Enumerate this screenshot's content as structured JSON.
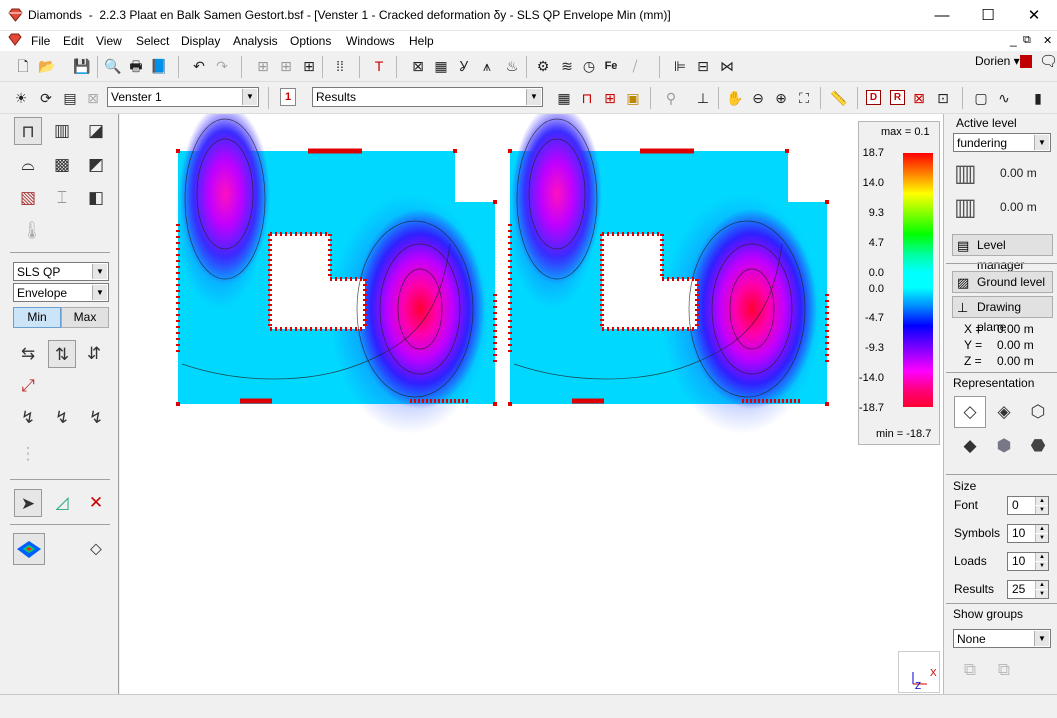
{
  "window": {
    "app_name": "Diamonds",
    "title_rest": "2.2.3 Plaat en Balk Samen Gestort.bsf - [Venster 1 - Cracked deformation δy - SLS QP Envelope Min  (mm)]",
    "minimize_glyph": "—",
    "maximize_glyph": "☐",
    "close_glyph": "✕"
  },
  "menu": {
    "items": [
      "File",
      "Edit",
      "View",
      "Select",
      "Display",
      "Analysis",
      "Options",
      "Windows",
      "Help"
    ],
    "user": "Dorien ▾",
    "mdi_min": "_",
    "mdi_restore": "⧉",
    "mdi_close": "✕"
  },
  "toolbar": {
    "window_combo": "Venster 1",
    "results_combo": "Results",
    "window_number": "1",
    "d_label": "D",
    "r_label": "R",
    "fe_label": "Fe"
  },
  "left_panel": {
    "combination_combo": "SLS QP",
    "envelope_combo": "Envelope",
    "min_tab": "Min",
    "max_tab": "Max"
  },
  "legend": {
    "max_label": "max = 0.1",
    "min_label": "min = -18.7",
    "ticks": [
      "18.7",
      "14.0",
      "9.3",
      "4.7",
      "0.0",
      "0.0",
      "-4.7",
      "-9.3",
      "-14.0",
      "-18.7"
    ]
  },
  "right_panel": {
    "active_level_title": "Active level",
    "level_combo": "fundering",
    "level_height_1": "0.00 m",
    "level_height_2": "0.00 m",
    "level_manager": "Level manager",
    "ground_level": "Ground level",
    "drawing_plane": "Drawing plane",
    "x_label": "X =",
    "x_value": "0.00 m",
    "y_label": "Y =",
    "y_value": "0.00 m",
    "z_label": "Z =",
    "z_value": "0.00 m",
    "representation_title": "Representation",
    "size_title": "Size",
    "font_label": "Font",
    "font_value": "0",
    "symbols_label": "Symbols",
    "symbols_value": "10",
    "loads_label": "Loads",
    "loads_value": "10",
    "results_label": "Results",
    "results_value": "25",
    "show_groups_title": "Show groups",
    "groups_combo": "None"
  },
  "axis_indicator": {
    "x": "X",
    "z": "Z"
  },
  "colors": {
    "contour_low": "#ff0033",
    "contour_mid": "#0000ff",
    "contour_high": "#00d8ff",
    "support_red": "#dd0000",
    "accent_red": "#cc0000"
  }
}
